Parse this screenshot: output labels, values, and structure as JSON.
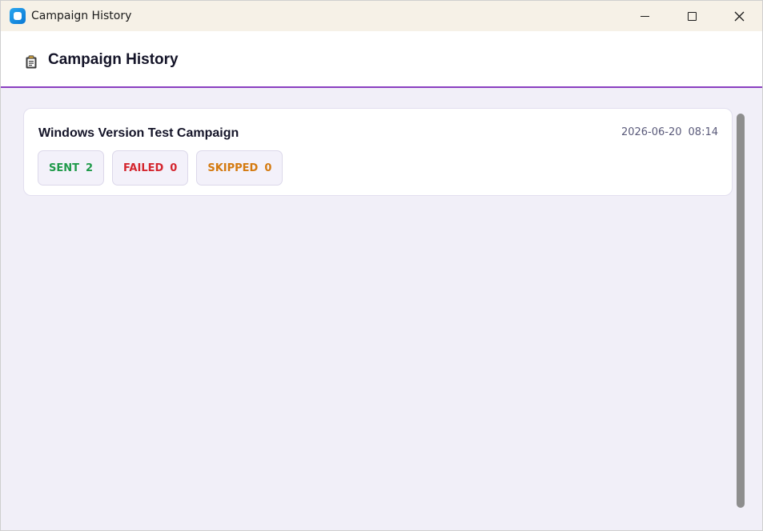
{
  "window": {
    "title": "Campaign History",
    "icons": {
      "app": "app-icon",
      "minimize": "minimize-icon",
      "maximize": "maximize-icon",
      "close": "close-icon"
    }
  },
  "header": {
    "title": "Campaign History",
    "icon": "clipboard-icon",
    "accent_color": "#8a3fc0"
  },
  "campaigns": [
    {
      "name": "Windows Version Test Campaign",
      "date": "2026-06-20",
      "time": "08:14",
      "stats": {
        "sent": {
          "label": "SENT",
          "value": "2",
          "color": "#1f9a4a"
        },
        "failed": {
          "label": "FAILED",
          "value": "0",
          "color": "#d4262f"
        },
        "skipped": {
          "label": "SKIPPED",
          "value": "0",
          "color": "#d47a10"
        }
      }
    }
  ]
}
